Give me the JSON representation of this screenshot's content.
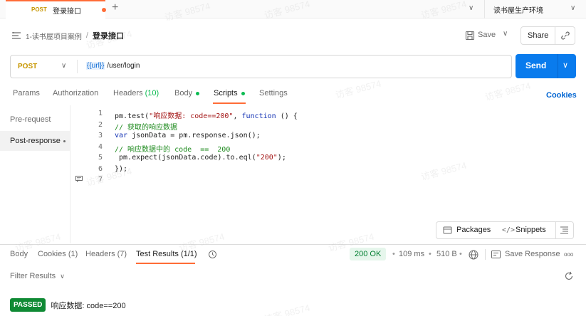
{
  "tab": {
    "method": "POST",
    "title": "登录接口"
  },
  "environment": {
    "name": "读书屋生产环境"
  },
  "breadcrumb": {
    "collection": "1-读书屋项目案例",
    "separator": "/",
    "current": "登录接口"
  },
  "toolbar": {
    "save_label": "Save",
    "share_label": "Share"
  },
  "request": {
    "method": "POST",
    "url_variable": "{{url}}",
    "url_path": " /user/login",
    "send_label": "Send"
  },
  "request_tabs": [
    {
      "label": "Params"
    },
    {
      "label": "Authorization"
    },
    {
      "label": "Headers",
      "count": "(10)"
    },
    {
      "label": "Body"
    },
    {
      "label": "Scripts"
    },
    {
      "label": "Settings"
    }
  ],
  "cookies_label": "Cookies",
  "script_sidebar": {
    "items": [
      "Pre-request",
      "Post-response"
    ]
  },
  "code_lines": [
    {
      "n": "1",
      "parts": [
        [
          "plain",
          "pm.test("
        ],
        [
          "str",
          "\"响应数据: code==200\""
        ],
        [
          "plain",
          ", "
        ],
        [
          "kw",
          "function"
        ],
        [
          "plain",
          " () {"
        ]
      ]
    },
    {
      "n": "2",
      "parts": [
        [
          "com",
          "// 获取的响应数据"
        ]
      ]
    },
    {
      "n": "3",
      "parts": [
        [
          "kw",
          "var"
        ],
        [
          "plain",
          " jsonData = pm.response.json();"
        ]
      ]
    },
    {
      "n": "4",
      "parts": [
        [
          "com",
          "// 响应数据中的 code  ==  200"
        ]
      ]
    },
    {
      "n": "5",
      "parts": [
        [
          "plain",
          " pm.expect(jsonData.code).to.eql("
        ],
        [
          "str",
          "\"200\""
        ],
        [
          "plain",
          ");"
        ]
      ]
    },
    {
      "n": "6",
      "parts": [
        [
          "plain",
          "});"
        ]
      ]
    },
    {
      "n": "7",
      "parts": [
        [
          "plain",
          ""
        ]
      ]
    }
  ],
  "editor_tools": {
    "packages_label": "Packages",
    "snippets_label": "Snippets"
  },
  "response_tabs": [
    {
      "label": "Body"
    },
    {
      "label": "Cookies",
      "count": "(1)"
    },
    {
      "label": "Headers",
      "count": "(7)"
    },
    {
      "label": "Test Results (1/1)"
    }
  ],
  "response_meta": {
    "status": "200 OK",
    "time": "109 ms",
    "size": "510 B",
    "save_response_label": "Save Response",
    "more": "ooo"
  },
  "filter_label": "Filter Results",
  "test_result": {
    "badge": "PASSED",
    "name": "响应数据: code==200"
  },
  "watermark": "访客 98574",
  "colors": {
    "accent": "#ff6c37",
    "send": "#097bed",
    "success": "#0cbb52",
    "method": "#c79600",
    "passed": "#0f8a34"
  }
}
